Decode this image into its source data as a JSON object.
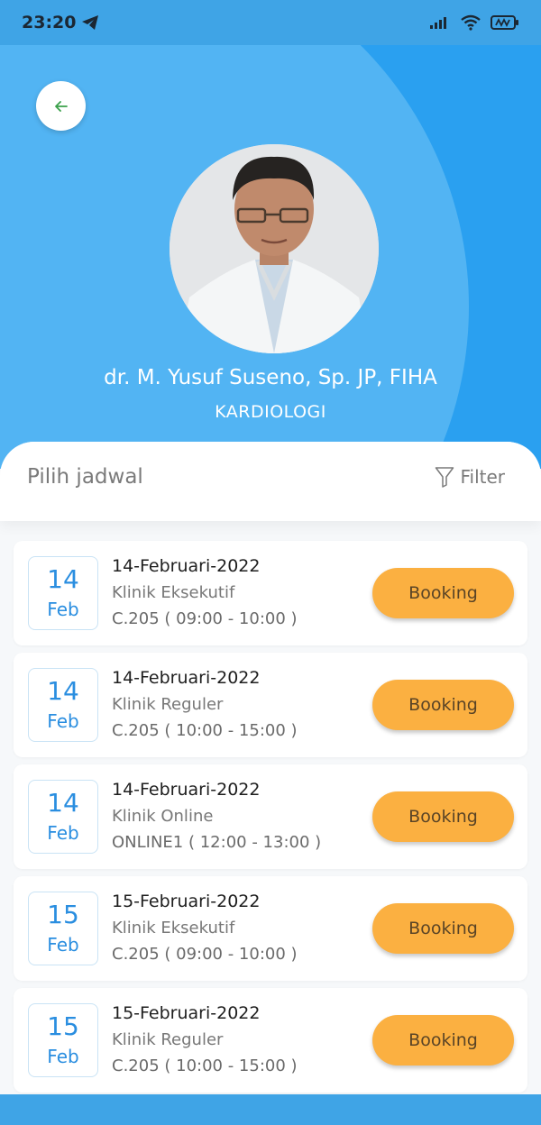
{
  "status_bar": {
    "time": "23:20"
  },
  "doctor": {
    "name": "dr. M. Yusuf Suseno, Sp. JP, FIHA",
    "specialty": "KARDIOLOGI"
  },
  "schedule": {
    "title": "Pilih jadwal",
    "filter_label": "Filter",
    "items": [
      {
        "day": "14",
        "month": "Feb",
        "date": "14-Februari-2022",
        "clinic": "Klinik Eksekutif",
        "room": "C.205 ( 09:00 - 10:00 )",
        "button": "Booking"
      },
      {
        "day": "14",
        "month": "Feb",
        "date": "14-Februari-2022",
        "clinic": "Klinik Reguler",
        "room": "C.205 ( 10:00 - 15:00 )",
        "button": "Booking"
      },
      {
        "day": "14",
        "month": "Feb",
        "date": "14-Februari-2022",
        "clinic": "Klinik Online",
        "room": "ONLINE1 ( 12:00 - 13:00 )",
        "button": "Booking"
      },
      {
        "day": "15",
        "month": "Feb",
        "date": "15-Februari-2022",
        "clinic": "Klinik Eksekutif",
        "room": "C.205 ( 09:00 - 10:00 )",
        "button": "Booking"
      },
      {
        "day": "15",
        "month": "Feb",
        "date": "15-Februari-2022",
        "clinic": "Klinik Reguler",
        "room": "C.205 ( 10:00 - 15:00 )",
        "button": "Booking"
      }
    ]
  },
  "colors": {
    "header_blue": "#2aa0f0",
    "booking_orange": "#fbb041",
    "date_blue": "#2a8ee0",
    "back_arrow_green": "#3aa04a"
  },
  "icons": {
    "back": "arrow-left-icon",
    "filter": "funnel-icon",
    "telegram": "telegram-icon",
    "signal": "signal-icon",
    "wifi": "wifi-icon",
    "battery": "battery-icon"
  }
}
